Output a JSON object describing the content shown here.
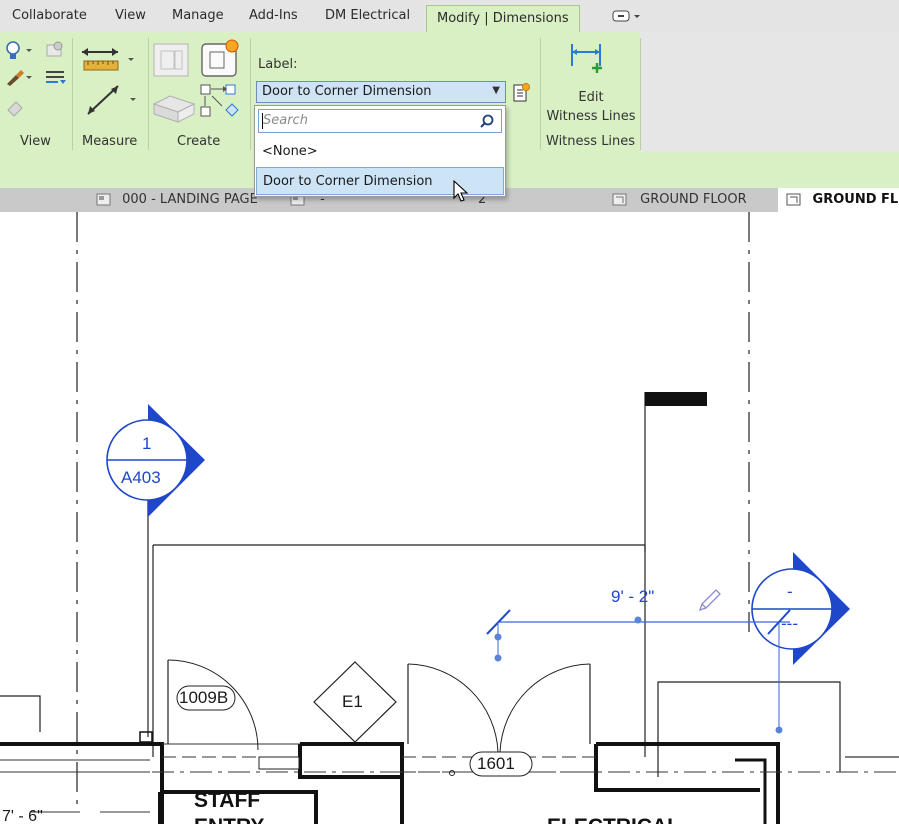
{
  "ribbon": {
    "tabs": [
      "Collaborate",
      "View",
      "Manage",
      "Add-Ins",
      "DM Electrical",
      "Modify | Dimensions"
    ],
    "panels": {
      "view": "View",
      "measure": "Measure",
      "create": "Create",
      "witness": "Witness Lines"
    },
    "label_caption": "Label:",
    "label_value": "Door to Corner Dimension",
    "edit_witness_line1": "Edit",
    "edit_witness_line2": "Witness Lines",
    "accent": "#d9efc4"
  },
  "dropdown": {
    "search_placeholder": "Search",
    "options": [
      "<None>",
      "Door to Corner Dimension"
    ]
  },
  "view_tabs": [
    "000 - LANDING PAGE",
    "-",
    "2",
    "GROUND FLOOR",
    "GROUND FL"
  ],
  "drawing": {
    "section_number": "1",
    "section_sheet": "A403",
    "section2_number": "-",
    "section2_sheet": "---",
    "dimension": "9' - 2\"",
    "door_tag_1": "1009B",
    "door_tag_2": "1601",
    "elec_tag": "E1",
    "room_name": "STAFF",
    "room_name_2": "ENTRY",
    "room_name_3": "ELECTRICAL",
    "left_dim": "7' - 6\"",
    "annotation_color": "#1f47c9"
  }
}
